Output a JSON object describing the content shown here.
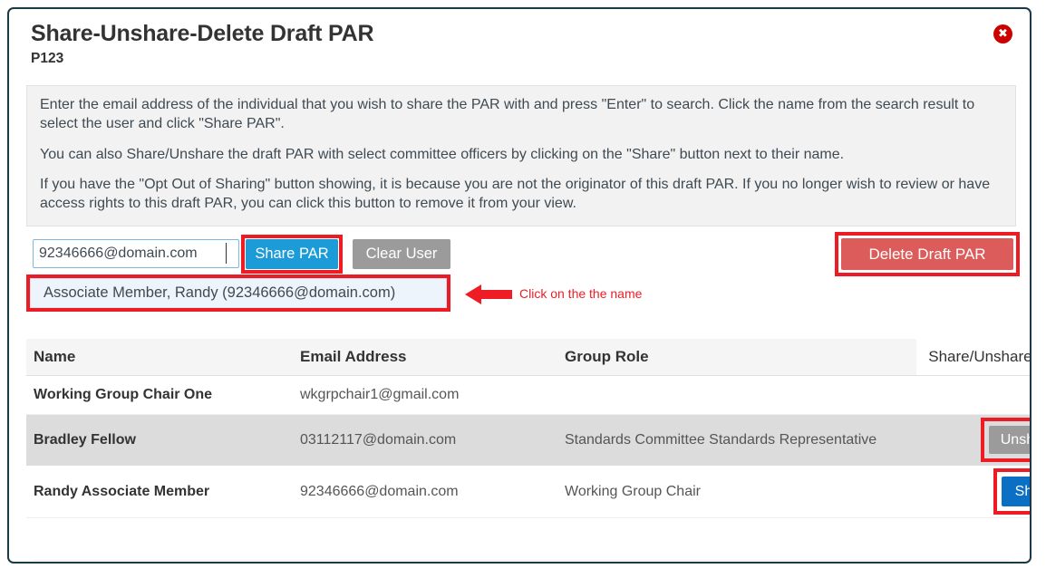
{
  "dialog": {
    "title": "Share-Unshare-Delete Draft PAR",
    "subtitle": "P123",
    "close_icon": "close-circle-icon",
    "close_glyph": "✖"
  },
  "instructions": {
    "paragraph_1": "Enter the email address of the individual that you wish to share the PAR with and press \"Enter\" to search. Click the name from the search result to select the user and click \"Share PAR\".",
    "paragraph_2": "You can also Share/Unshare the draft PAR with select committee officers by clicking on the \"Share\" button next to their name.",
    "paragraph_3": "If you have the \"Opt Out of Sharing\" button showing, it is because you are not the originator of this draft PAR. If you no longer wish to review or have access rights to this draft PAR, you can click this button to remove it from your view."
  },
  "search": {
    "value": "92346666@domain.com",
    "placeholder": "",
    "share_par_label": "Share PAR",
    "clear_user_label": "Clear User",
    "delete_draft_par_label": "Delete Draft PAR",
    "suggestion": "Associate Member, Randy (92346666@domain.com)"
  },
  "annotation": {
    "arrow_icon": "left-arrow-icon",
    "label": "Click on the the name"
  },
  "table": {
    "columns": [
      "Name",
      "Email Address",
      "Group Role",
      "Share/Unshare PAR"
    ],
    "rows": [
      {
        "name": "Working Group Chair One",
        "email": "wkgrpchair1@gmail.com",
        "role": "",
        "action": ""
      },
      {
        "name": "Bradley Fellow",
        "email": "03112117@domain.com",
        "role": "Standards Committee Standards Representative",
        "action": "Unshare"
      },
      {
        "name": "Randy Associate Member",
        "email": "92346666@domain.com",
        "role": "Working Group Chair",
        "action": "Share"
      }
    ]
  },
  "colors": {
    "share_par_blue": "#1b9bd7",
    "clear_user_gray": "#9b9b9b",
    "delete_red": "#dc5c5c",
    "row_share_blue": "#0b6fc4",
    "annotation_red": "#ed1c24",
    "close_red": "#cc0000",
    "panel_gray": "#f2f2f2",
    "shaded_row": "#dcdcdc",
    "border_navy": "#1b3a47"
  }
}
